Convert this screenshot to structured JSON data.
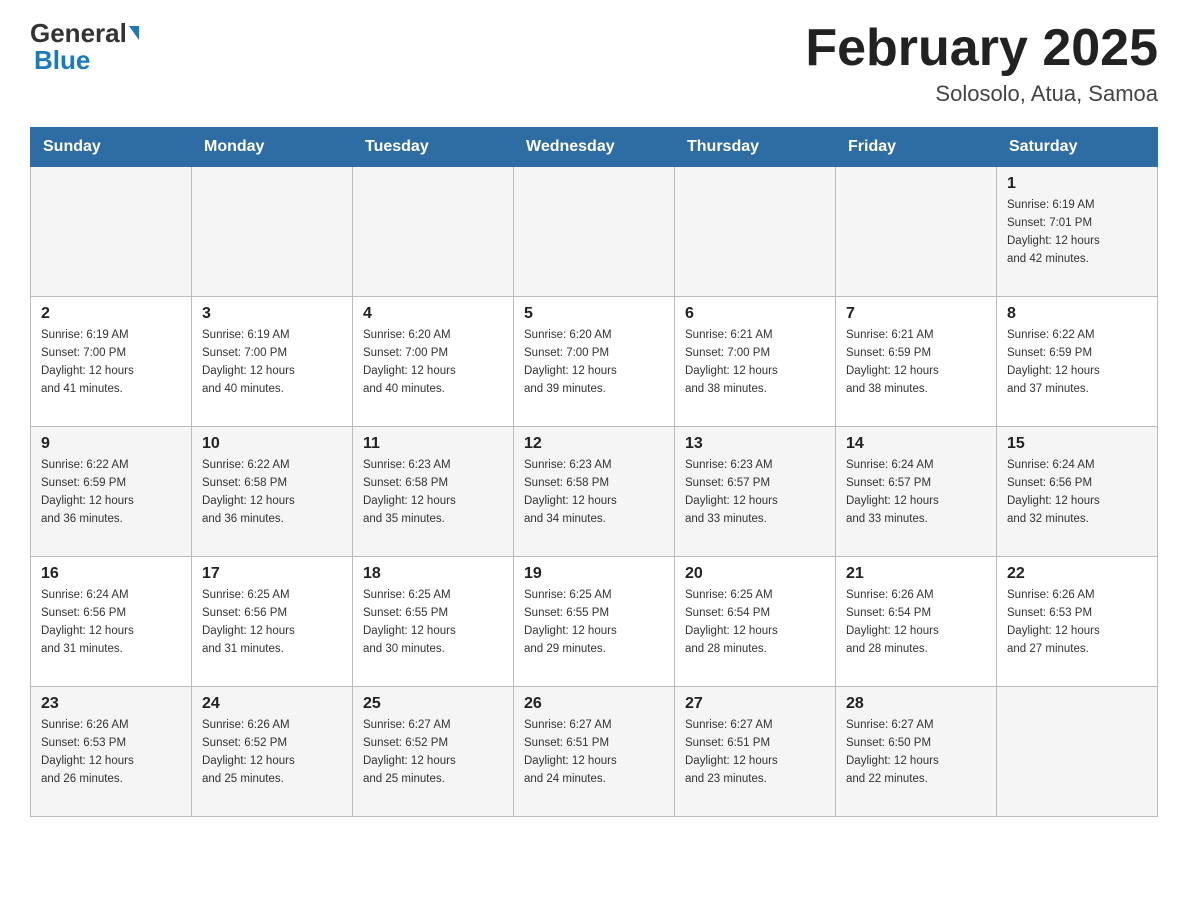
{
  "header": {
    "logo_general": "General",
    "logo_blue": "Blue",
    "title": "February 2025",
    "subtitle": "Solosolo, Atua, Samoa"
  },
  "weekdays": [
    "Sunday",
    "Monday",
    "Tuesday",
    "Wednesday",
    "Thursday",
    "Friday",
    "Saturday"
  ],
  "weeks": [
    [
      {
        "day": "",
        "info": ""
      },
      {
        "day": "",
        "info": ""
      },
      {
        "day": "",
        "info": ""
      },
      {
        "day": "",
        "info": ""
      },
      {
        "day": "",
        "info": ""
      },
      {
        "day": "",
        "info": ""
      },
      {
        "day": "1",
        "info": "Sunrise: 6:19 AM\nSunset: 7:01 PM\nDaylight: 12 hours\nand 42 minutes."
      }
    ],
    [
      {
        "day": "2",
        "info": "Sunrise: 6:19 AM\nSunset: 7:00 PM\nDaylight: 12 hours\nand 41 minutes."
      },
      {
        "day": "3",
        "info": "Sunrise: 6:19 AM\nSunset: 7:00 PM\nDaylight: 12 hours\nand 40 minutes."
      },
      {
        "day": "4",
        "info": "Sunrise: 6:20 AM\nSunset: 7:00 PM\nDaylight: 12 hours\nand 40 minutes."
      },
      {
        "day": "5",
        "info": "Sunrise: 6:20 AM\nSunset: 7:00 PM\nDaylight: 12 hours\nand 39 minutes."
      },
      {
        "day": "6",
        "info": "Sunrise: 6:21 AM\nSunset: 7:00 PM\nDaylight: 12 hours\nand 38 minutes."
      },
      {
        "day": "7",
        "info": "Sunrise: 6:21 AM\nSunset: 6:59 PM\nDaylight: 12 hours\nand 38 minutes."
      },
      {
        "day": "8",
        "info": "Sunrise: 6:22 AM\nSunset: 6:59 PM\nDaylight: 12 hours\nand 37 minutes."
      }
    ],
    [
      {
        "day": "9",
        "info": "Sunrise: 6:22 AM\nSunset: 6:59 PM\nDaylight: 12 hours\nand 36 minutes."
      },
      {
        "day": "10",
        "info": "Sunrise: 6:22 AM\nSunset: 6:58 PM\nDaylight: 12 hours\nand 36 minutes."
      },
      {
        "day": "11",
        "info": "Sunrise: 6:23 AM\nSunset: 6:58 PM\nDaylight: 12 hours\nand 35 minutes."
      },
      {
        "day": "12",
        "info": "Sunrise: 6:23 AM\nSunset: 6:58 PM\nDaylight: 12 hours\nand 34 minutes."
      },
      {
        "day": "13",
        "info": "Sunrise: 6:23 AM\nSunset: 6:57 PM\nDaylight: 12 hours\nand 33 minutes."
      },
      {
        "day": "14",
        "info": "Sunrise: 6:24 AM\nSunset: 6:57 PM\nDaylight: 12 hours\nand 33 minutes."
      },
      {
        "day": "15",
        "info": "Sunrise: 6:24 AM\nSunset: 6:56 PM\nDaylight: 12 hours\nand 32 minutes."
      }
    ],
    [
      {
        "day": "16",
        "info": "Sunrise: 6:24 AM\nSunset: 6:56 PM\nDaylight: 12 hours\nand 31 minutes."
      },
      {
        "day": "17",
        "info": "Sunrise: 6:25 AM\nSunset: 6:56 PM\nDaylight: 12 hours\nand 31 minutes."
      },
      {
        "day": "18",
        "info": "Sunrise: 6:25 AM\nSunset: 6:55 PM\nDaylight: 12 hours\nand 30 minutes."
      },
      {
        "day": "19",
        "info": "Sunrise: 6:25 AM\nSunset: 6:55 PM\nDaylight: 12 hours\nand 29 minutes."
      },
      {
        "day": "20",
        "info": "Sunrise: 6:25 AM\nSunset: 6:54 PM\nDaylight: 12 hours\nand 28 minutes."
      },
      {
        "day": "21",
        "info": "Sunrise: 6:26 AM\nSunset: 6:54 PM\nDaylight: 12 hours\nand 28 minutes."
      },
      {
        "day": "22",
        "info": "Sunrise: 6:26 AM\nSunset: 6:53 PM\nDaylight: 12 hours\nand 27 minutes."
      }
    ],
    [
      {
        "day": "23",
        "info": "Sunrise: 6:26 AM\nSunset: 6:53 PM\nDaylight: 12 hours\nand 26 minutes."
      },
      {
        "day": "24",
        "info": "Sunrise: 6:26 AM\nSunset: 6:52 PM\nDaylight: 12 hours\nand 25 minutes."
      },
      {
        "day": "25",
        "info": "Sunrise: 6:27 AM\nSunset: 6:52 PM\nDaylight: 12 hours\nand 25 minutes."
      },
      {
        "day": "26",
        "info": "Sunrise: 6:27 AM\nSunset: 6:51 PM\nDaylight: 12 hours\nand 24 minutes."
      },
      {
        "day": "27",
        "info": "Sunrise: 6:27 AM\nSunset: 6:51 PM\nDaylight: 12 hours\nand 23 minutes."
      },
      {
        "day": "28",
        "info": "Sunrise: 6:27 AM\nSunset: 6:50 PM\nDaylight: 12 hours\nand 22 minutes."
      },
      {
        "day": "",
        "info": ""
      }
    ]
  ]
}
